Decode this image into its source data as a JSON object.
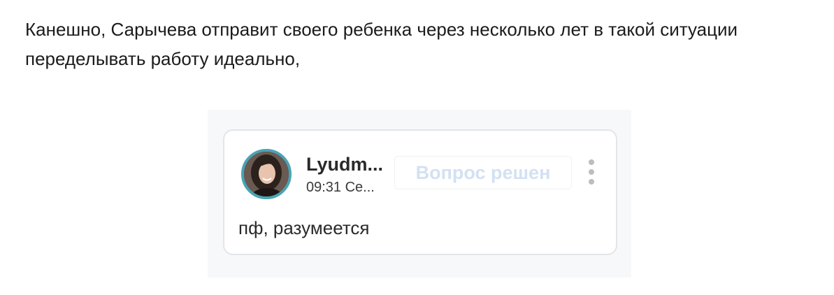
{
  "article": {
    "text": "Канешно, Сарычева отправит своего ребенка через несколько лет в такой ситуации переделывать работу идеально,"
  },
  "comment": {
    "author": "Lyudm...",
    "time": "09:31 Се...",
    "resolve_label": "Вопрос решен",
    "more_icon": "vertical-dots-icon",
    "body": "пф, разумеется"
  },
  "colors": {
    "avatar_ring": "#4aa3b4",
    "resolve_text": "#d3e1f3",
    "frame_bg": "#f7f8f9"
  }
}
